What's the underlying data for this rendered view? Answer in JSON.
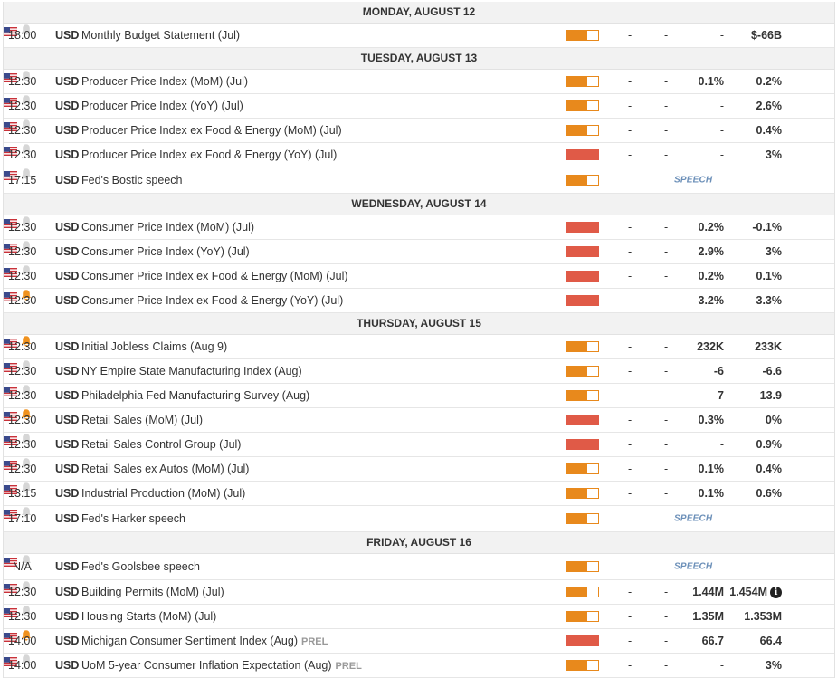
{
  "days": [
    {
      "label": "MONDAY, AUGUST 12",
      "events": [
        {
          "time": "18:00",
          "currency": "USD",
          "name": "Monthly Budget Statement (Jul)",
          "importance": "medium",
          "f1": "-",
          "f2": "-",
          "f3": "-",
          "f4": "$-66B",
          "alert": false
        }
      ]
    },
    {
      "label": "TUESDAY, AUGUST 13",
      "events": [
        {
          "time": "12:30",
          "currency": "USD",
          "name": "Producer Price Index (MoM) (Jul)",
          "importance": "medium",
          "f1": "-",
          "f2": "-",
          "f3": "0.1%",
          "f4": "0.2%",
          "alert": false
        },
        {
          "time": "12:30",
          "currency": "USD",
          "name": "Producer Price Index (YoY) (Jul)",
          "importance": "medium",
          "f1": "-",
          "f2": "-",
          "f3": "-",
          "f4": "2.6%",
          "alert": false
        },
        {
          "time": "12:30",
          "currency": "USD",
          "name": "Producer Price Index ex Food & Energy (MoM) (Jul)",
          "importance": "medium",
          "f1": "-",
          "f2": "-",
          "f3": "-",
          "f4": "0.4%",
          "alert": false
        },
        {
          "time": "12:30",
          "currency": "USD",
          "name": "Producer Price Index ex Food & Energy (YoY) (Jul)",
          "importance": "high",
          "f1": "-",
          "f2": "-",
          "f3": "-",
          "f4": "3%",
          "alert": false
        },
        {
          "time": "17:15",
          "currency": "USD",
          "name": "Fed's Bostic speech",
          "importance": "medium",
          "speech": "SPEECH",
          "alert": false
        }
      ]
    },
    {
      "label": "WEDNESDAY, AUGUST 14",
      "events": [
        {
          "time": "12:30",
          "currency": "USD",
          "name": "Consumer Price Index (MoM) (Jul)",
          "importance": "high",
          "f1": "-",
          "f2": "-",
          "f3": "0.2%",
          "f4": "-0.1%",
          "alert": false
        },
        {
          "time": "12:30",
          "currency": "USD",
          "name": "Consumer Price Index (YoY) (Jul)",
          "importance": "high",
          "f1": "-",
          "f2": "-",
          "f3": "2.9%",
          "f4": "3%",
          "alert": false
        },
        {
          "time": "12:30",
          "currency": "USD",
          "name": "Consumer Price Index ex Food & Energy (MoM) (Jul)",
          "importance": "high",
          "f1": "-",
          "f2": "-",
          "f3": "0.2%",
          "f4": "0.1%",
          "alert": false
        },
        {
          "time": "12:30",
          "currency": "USD",
          "name": "Consumer Price Index ex Food & Energy (YoY) (Jul)",
          "importance": "high",
          "f1": "-",
          "f2": "-",
          "f3": "3.2%",
          "f4": "3.3%",
          "alert": true
        }
      ]
    },
    {
      "label": "THURSDAY, AUGUST 15",
      "events": [
        {
          "time": "12:30",
          "currency": "USD",
          "name": "Initial Jobless Claims (Aug 9)",
          "importance": "medium",
          "f1": "-",
          "f2": "-",
          "f3": "232K",
          "f4": "233K",
          "alert": true
        },
        {
          "time": "12:30",
          "currency": "USD",
          "name": "NY Empire State Manufacturing Index (Aug)",
          "importance": "medium",
          "f1": "-",
          "f2": "-",
          "f3": "-6",
          "f4": "-6.6",
          "alert": false
        },
        {
          "time": "12:30",
          "currency": "USD",
          "name": "Philadelphia Fed Manufacturing Survey (Aug)",
          "importance": "medium",
          "f1": "-",
          "f2": "-",
          "f3": "7",
          "f4": "13.9",
          "alert": false
        },
        {
          "time": "12:30",
          "currency": "USD",
          "name": "Retail Sales (MoM) (Jul)",
          "importance": "high",
          "f1": "-",
          "f2": "-",
          "f3": "0.3%",
          "f4": "0%",
          "alert": true
        },
        {
          "time": "12:30",
          "currency": "USD",
          "name": "Retail Sales Control Group (Jul)",
          "importance": "high",
          "f1": "-",
          "f2": "-",
          "f3": "-",
          "f4": "0.9%",
          "alert": false
        },
        {
          "time": "12:30",
          "currency": "USD",
          "name": "Retail Sales ex Autos (MoM) (Jul)",
          "importance": "medium",
          "f1": "-",
          "f2": "-",
          "f3": "0.1%",
          "f4": "0.4%",
          "alert": false
        },
        {
          "time": "13:15",
          "currency": "USD",
          "name": "Industrial Production (MoM) (Jul)",
          "importance": "medium",
          "f1": "-",
          "f2": "-",
          "f3": "0.1%",
          "f4": "0.6%",
          "alert": false
        },
        {
          "time": "17:10",
          "currency": "USD",
          "name": "Fed's Harker speech",
          "importance": "medium",
          "speech": "SPEECH",
          "alert": false
        }
      ]
    },
    {
      "label": "FRIDAY, AUGUST 16",
      "events": [
        {
          "time": "N/A",
          "currency": "USD",
          "name": "Fed's Goolsbee speech",
          "importance": "medium",
          "speech": "SPEECH",
          "alert": false
        },
        {
          "time": "12:30",
          "currency": "USD",
          "name": "Building Permits (MoM) (Jul)",
          "importance": "medium",
          "f1": "-",
          "f2": "-",
          "f3": "1.44M",
          "f4": "1.454M",
          "info": "i",
          "alert": false
        },
        {
          "time": "12:30",
          "currency": "USD",
          "name": "Housing Starts (MoM) (Jul)",
          "importance": "medium",
          "f1": "-",
          "f2": "-",
          "f3": "1.35M",
          "f4": "1.353M",
          "alert": false
        },
        {
          "time": "14:00",
          "currency": "USD",
          "name": "Michigan Consumer Sentiment Index (Aug)",
          "tag": "PREL",
          "importance": "high",
          "f1": "-",
          "f2": "-",
          "f3": "66.7",
          "f4": "66.4",
          "alert": true
        },
        {
          "time": "14:00",
          "currency": "USD",
          "name": "UoM 5-year Consumer Inflation Expectation (Aug)",
          "tag": "PREL",
          "importance": "medium",
          "f1": "-",
          "f2": "-",
          "f3": "-",
          "f4": "3%",
          "alert": false
        }
      ]
    }
  ],
  "colors": {
    "medium": "#e8891c",
    "high": "#e05a47",
    "bell_on": "#f0921e",
    "bell_off": "#d6d6d6",
    "speech": "#6b8fb8"
  }
}
